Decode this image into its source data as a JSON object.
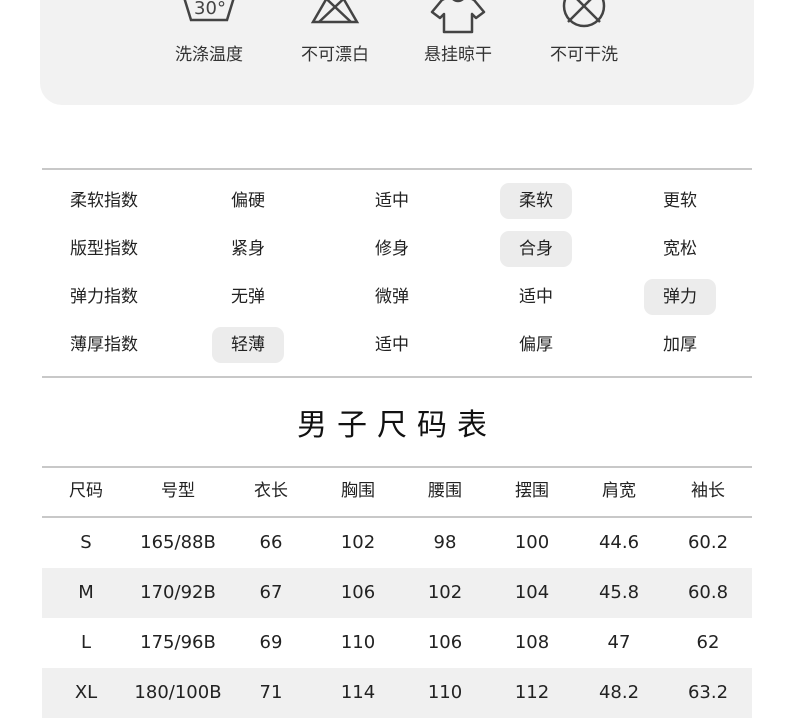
{
  "care": {
    "items": [
      {
        "icon": "wash-30-icon",
        "badge": "30°",
        "label": "洗涤温度"
      },
      {
        "icon": "no-bleach-icon",
        "label": "不可漂白"
      },
      {
        "icon": "hang-dry-icon",
        "label": "悬挂晾干"
      },
      {
        "icon": "no-dry-clean-icon",
        "label": "不可干洗"
      }
    ]
  },
  "attributes": {
    "rows": [
      {
        "name": "柔软指数",
        "options": [
          "偏硬",
          "适中",
          "柔软",
          "更软"
        ],
        "selected_index": 2
      },
      {
        "name": "版型指数",
        "options": [
          "紧身",
          "修身",
          "合身",
          "宽松"
        ],
        "selected_index": 2
      },
      {
        "name": "弹力指数",
        "options": [
          "无弹",
          "微弹",
          "适中",
          "弹力"
        ],
        "selected_index": 3
      },
      {
        "name": "薄厚指数",
        "options": [
          "轻薄",
          "适中",
          "偏厚",
          "加厚"
        ],
        "selected_index": 0
      }
    ]
  },
  "size_chart": {
    "title": "男子尺码表",
    "headers": [
      "尺码",
      "号型",
      "衣长",
      "胸围",
      "腰围",
      "摆围",
      "肩宽",
      "袖长"
    ],
    "rows": [
      [
        "S",
        "165/88B",
        "66",
        "102",
        "98",
        "100",
        "44.6",
        "60.2"
      ],
      [
        "M",
        "170/92B",
        "67",
        "106",
        "102",
        "104",
        "45.8",
        "60.8"
      ],
      [
        "L",
        "175/96B",
        "69",
        "110",
        "106",
        "108",
        "47",
        "62"
      ],
      [
        "XL",
        "180/100B",
        "71",
        "114",
        "110",
        "112",
        "48.2",
        "63.2"
      ]
    ]
  },
  "colors": {
    "panel_bg": "#f2f2f2",
    "selected_bg": "#ececec",
    "row_shade": "#f0f0f0",
    "rule": "#c8c8c8"
  }
}
